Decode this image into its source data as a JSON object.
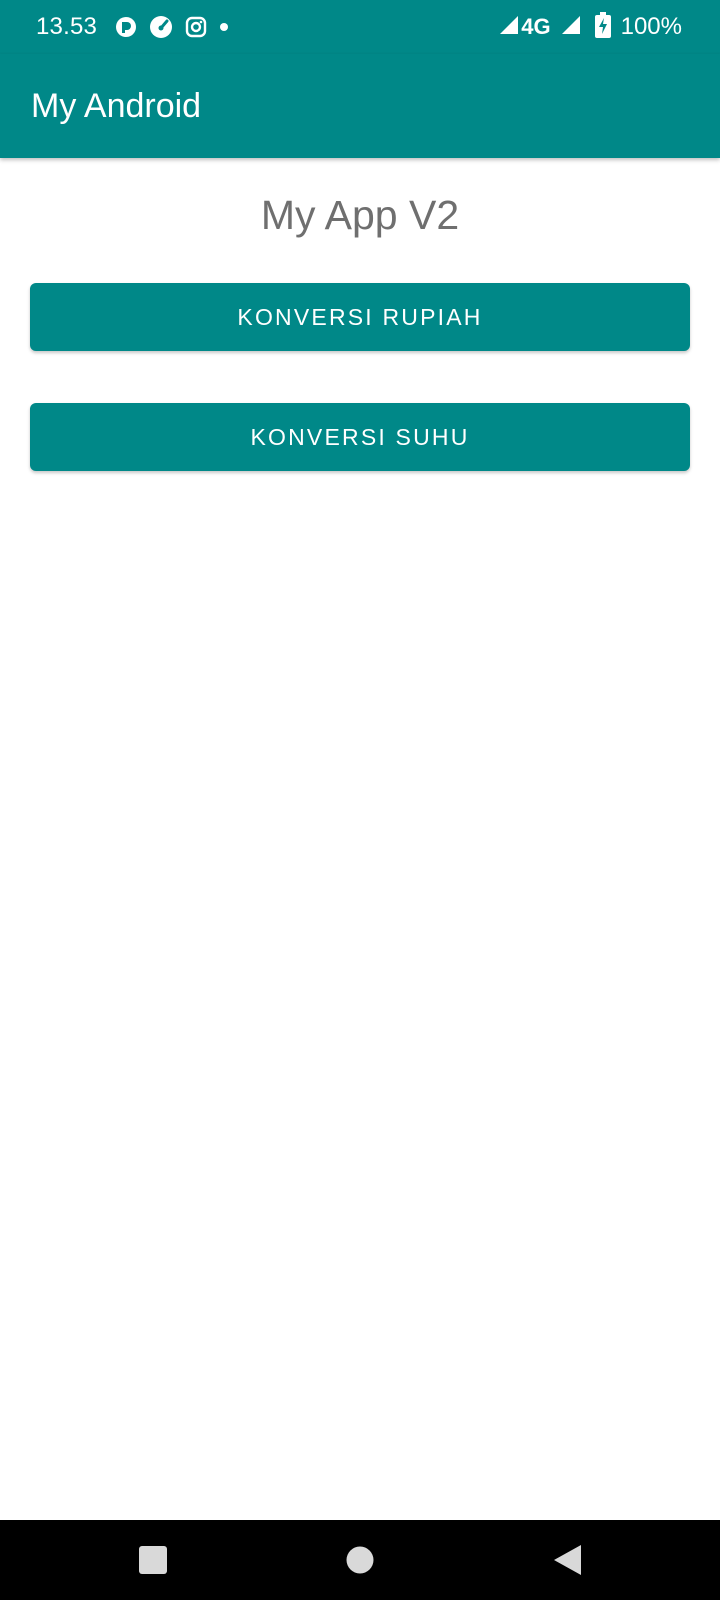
{
  "status_bar": {
    "time": "13.53",
    "network": "4G",
    "battery": "100%",
    "left_icons": [
      "app-notification-icon",
      "speedometer-icon",
      "instagram-icon",
      "more-notifications-dot-icon"
    ],
    "right_icons": [
      "signal-icon",
      "signal-icon",
      "battery-charging-icon"
    ]
  },
  "app_bar": {
    "title": "My Android",
    "color": "#008888"
  },
  "main": {
    "title": "My App V2",
    "buttons": [
      {
        "label": "KONVERSI RUPIAH"
      },
      {
        "label": "KONVERSI SUHU"
      }
    ]
  },
  "nav_bar": {
    "buttons": [
      "recents-icon",
      "home-icon",
      "back-icon"
    ]
  }
}
